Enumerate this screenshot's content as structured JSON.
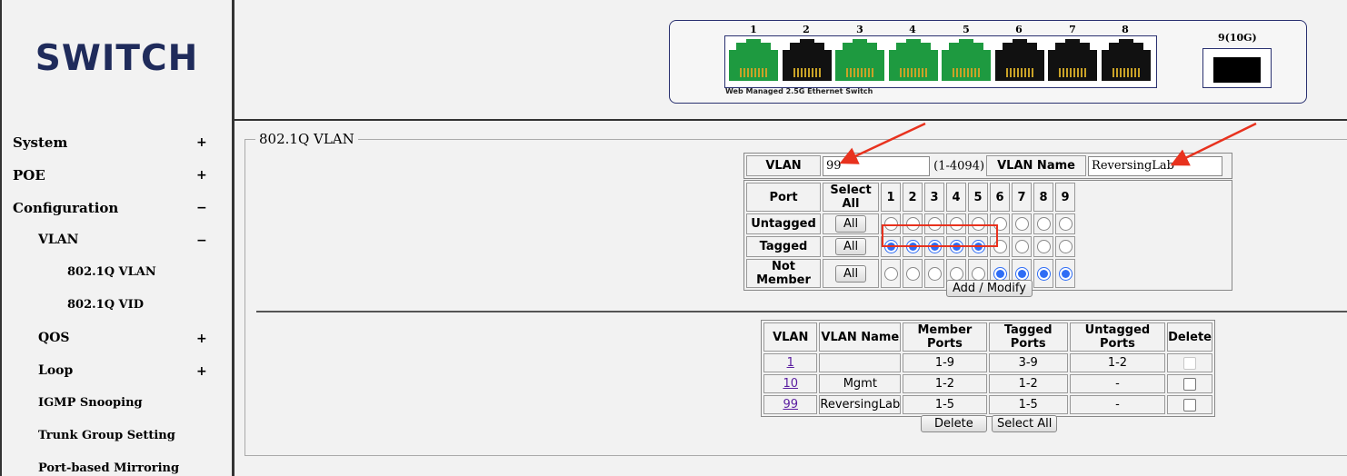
{
  "sidebar": {
    "logo": "SWITCH",
    "items": [
      {
        "label": "System",
        "sign": "+",
        "level": 1
      },
      {
        "label": "POE",
        "sign": "+",
        "level": 1
      },
      {
        "label": "Configuration",
        "sign": "−",
        "level": 1
      },
      {
        "label": "VLAN",
        "sign": "−",
        "level": 2
      },
      {
        "label": "802.1Q VLAN",
        "sign": "",
        "level": 3
      },
      {
        "label": "802.1Q VID",
        "sign": "",
        "level": 3
      },
      {
        "label": "QOS",
        "sign": "+",
        "level": 2
      },
      {
        "label": "Loop",
        "sign": "+",
        "level": 2
      },
      {
        "label": "IGMP Snooping",
        "sign": "",
        "level": 2
      },
      {
        "label": "Trunk Group Setting",
        "sign": "",
        "level": 2
      },
      {
        "label": "Port-based Mirroring",
        "sign": "",
        "level": 2
      }
    ]
  },
  "switch_panel": {
    "port_numbers": [
      "1",
      "2",
      "3",
      "4",
      "5",
      "6",
      "7",
      "8"
    ],
    "port_status": [
      "green",
      "black",
      "green",
      "green",
      "green",
      "black",
      "black",
      "black"
    ],
    "caption": "Web Managed 2.5G Ethernet Switch",
    "sfp_label": "9(10G)"
  },
  "section_title": "802.1Q VLAN",
  "form": {
    "vlan_label": "VLAN",
    "vlan_value": "99",
    "vlan_range": "(1-4094)",
    "vlan_name_label": "VLAN Name",
    "vlan_name_value": "ReversingLab",
    "port_header": "Port",
    "select_all_header": "Select All",
    "ports": [
      "1",
      "2",
      "3",
      "4",
      "5",
      "6",
      "7",
      "8",
      "9"
    ],
    "rows": [
      {
        "label": "Untagged",
        "button": "All",
        "selected": [
          false,
          false,
          false,
          false,
          false,
          false,
          false,
          false,
          false
        ]
      },
      {
        "label": "Tagged",
        "button": "All",
        "selected": [
          true,
          true,
          true,
          true,
          true,
          false,
          false,
          false,
          false
        ]
      },
      {
        "label": "Not Member",
        "button": "All",
        "selected": [
          false,
          false,
          false,
          false,
          false,
          true,
          true,
          true,
          true
        ]
      }
    ],
    "add_modify_button": "Add / Modify"
  },
  "vlan_table": {
    "headers": [
      "VLAN",
      "VLAN Name",
      "Member Ports",
      "Tagged Ports",
      "Untagged Ports",
      "Delete"
    ],
    "rows": [
      {
        "vlan": "1",
        "name": "",
        "member": "1-9",
        "tagged": "3-9",
        "untagged": "1-2",
        "deletable": false
      },
      {
        "vlan": "10",
        "name": "Mgmt",
        "member": "1-2",
        "tagged": "1-2",
        "untagged": "-",
        "deletable": true
      },
      {
        "vlan": "99",
        "name": "ReversingLab",
        "member": "1-5",
        "tagged": "1-5",
        "untagged": "-",
        "deletable": true
      }
    ],
    "delete_button": "Delete",
    "select_all_button": "Select All"
  },
  "colors": {
    "accent_radio": "#2f6df5",
    "annotation_red": "#e8321e",
    "port_active": "#1e9a40",
    "logo": "#1f2b5b"
  }
}
